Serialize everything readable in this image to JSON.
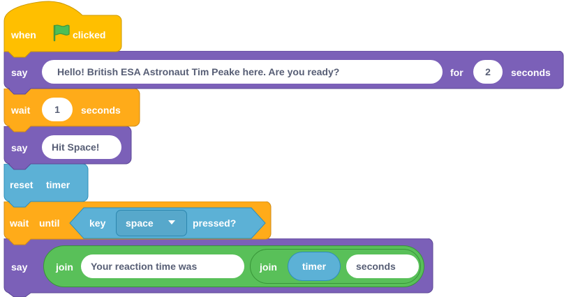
{
  "script": {
    "hat": {
      "when": "when",
      "clicked": "clicked",
      "flag_icon": "green-flag-icon"
    },
    "say1": {
      "say": "say",
      "message": "Hello! British ESA Astronaut Tim Peake here. Are you ready?",
      "for": "for",
      "secs": "2",
      "seconds": "seconds"
    },
    "wait1": {
      "wait": "wait",
      "secs": "1",
      "seconds": "seconds"
    },
    "say2": {
      "say": "say",
      "message": "Hit Space!"
    },
    "reset": {
      "reset": "reset",
      "timer": "timer"
    },
    "wait_until": {
      "wait": "wait",
      "until": "until",
      "key": "key",
      "key_value": "space",
      "pressed": "pressed?",
      "dropdown_icon": "caret-down-icon"
    },
    "say3": {
      "say": "say",
      "join1": "join",
      "text1": "Your reaction time was",
      "join2": "join",
      "timer": "timer",
      "text2": "seconds"
    }
  },
  "colors": {
    "events": "#ffbf00",
    "events_border": "#cc9900",
    "looks": "#9966ff",
    "looks_dark": "#7d61b1",
    "looks_border": "#5e4996",
    "control": "#ffab19",
    "control_border": "#cf8b17",
    "sensing": "#5cb1d6",
    "sensing_border": "#2e8eb8",
    "operators": "#59c059",
    "operators_border": "#389438",
    "flag": "#4cbf56"
  }
}
